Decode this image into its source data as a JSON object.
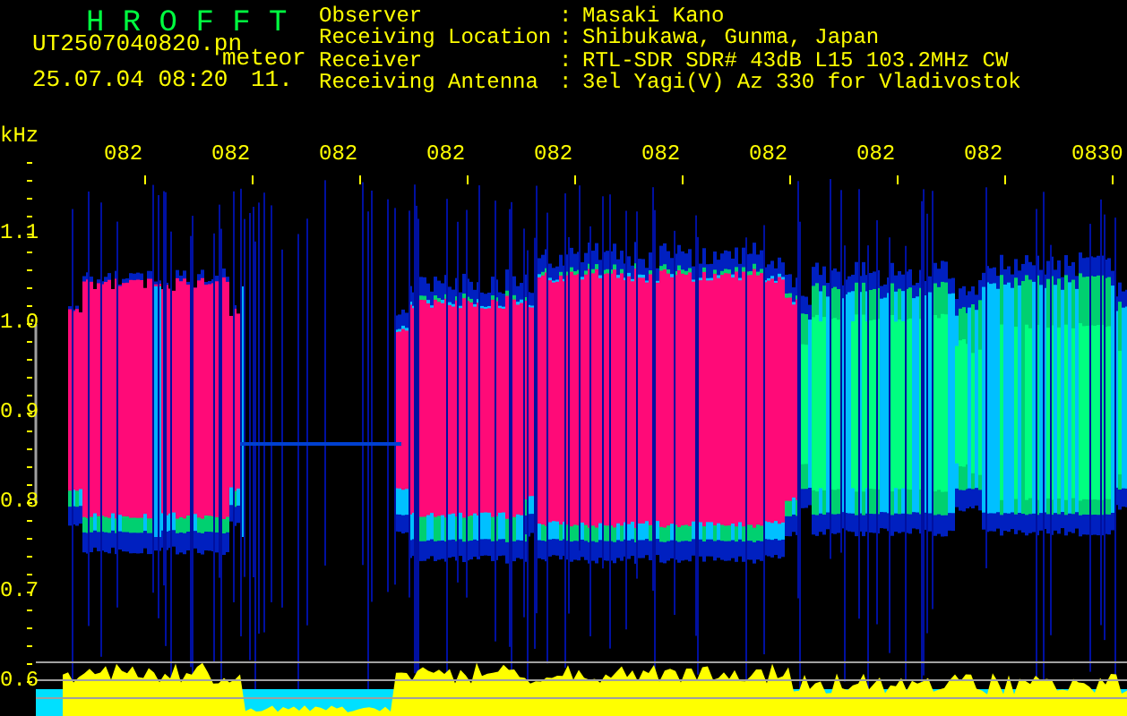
{
  "header": {
    "logo": "H R O F F T",
    "file_name": "UT2507040820.pn",
    "event_type": "meteor",
    "date_time": "25.07.04 08:20",
    "count": "11.",
    "info": [
      {
        "label": "Observer",
        "separator": ":",
        "value": "Masaki Kano"
      },
      {
        "label": "Receiving Location",
        "separator": ":",
        "value": "Shibukawa, Gunma, Japan"
      },
      {
        "label": "Receiver",
        "separator": ":",
        "value": "RTL-SDR SDR# 43dB L15 103.2MHz CW"
      },
      {
        "label": "Receiving Antenna",
        "separator": ":",
        "value": "3el Yagi(V) Az 330 for Vladivostok"
      }
    ]
  },
  "plot": {
    "unit": "kHz",
    "frequency_labels": [
      "1.1",
      "1.0",
      "0.9",
      "0.8",
      "0.7",
      "0.6"
    ],
    "time_labels": [
      "082",
      "082",
      "082",
      "082",
      "082",
      "082",
      "082",
      "082",
      "082",
      "0830"
    ]
  }
}
